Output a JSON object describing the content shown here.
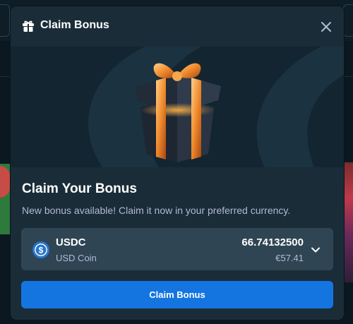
{
  "modal": {
    "title": "Claim Bonus",
    "heading": "Claim Your Bonus",
    "description": "New bonus available! Claim it now in your preferred currency."
  },
  "currency": {
    "code": "USDC",
    "name": "USD Coin",
    "amount": "66.74132500",
    "fiat_value": "€57.41",
    "icon": "usdc-coin-icon"
  },
  "actions": {
    "claim_label": "Claim Bonus"
  },
  "colors": {
    "modal_bg": "#1a2c38",
    "select_bg": "#2f4553",
    "primary_button": "#1475e1",
    "muted_text": "#b1bad3",
    "usdc_blue": "#2775ca"
  }
}
